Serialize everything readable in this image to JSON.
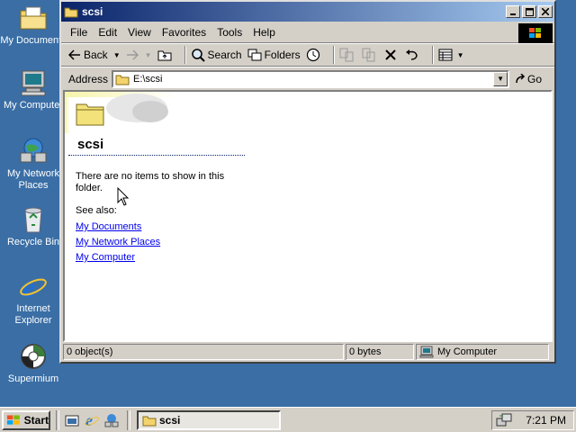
{
  "desktop": {
    "icons": [
      {
        "label": "My Documents",
        "icon": "my-documents-icon"
      },
      {
        "label": "My Computer",
        "icon": "my-computer-icon"
      },
      {
        "label": "My Network Places",
        "icon": "network-places-icon"
      },
      {
        "label": "Recycle Bin",
        "icon": "recycle-bin-icon"
      },
      {
        "label": "Internet Explorer",
        "icon": "internet-explorer-icon"
      },
      {
        "label": "Supermium",
        "icon": "supermium-icon"
      }
    ]
  },
  "window": {
    "title": "scsi",
    "menu": [
      "File",
      "Edit",
      "View",
      "Favorites",
      "Tools",
      "Help"
    ],
    "toolbar": {
      "back": "Back",
      "search": "Search",
      "folders": "Folders"
    },
    "address": {
      "label": "Address",
      "value": "E:\\scsi",
      "go": "Go"
    },
    "content": {
      "heading": "scsi",
      "message": "There are no items to show in this folder.",
      "see_also": "See also:",
      "links": [
        "My Documents",
        "My Network Places",
        "My Computer"
      ]
    },
    "status": {
      "objects": "0 object(s)",
      "size": "0 bytes",
      "zone": "My Computer"
    }
  },
  "taskbar": {
    "start": "Start",
    "task": "scsi",
    "clock": "7:21 PM"
  },
  "colors": {
    "desktop": "#3a6ea5",
    "titlebar": "#0a246a",
    "link": "#0000ee"
  }
}
